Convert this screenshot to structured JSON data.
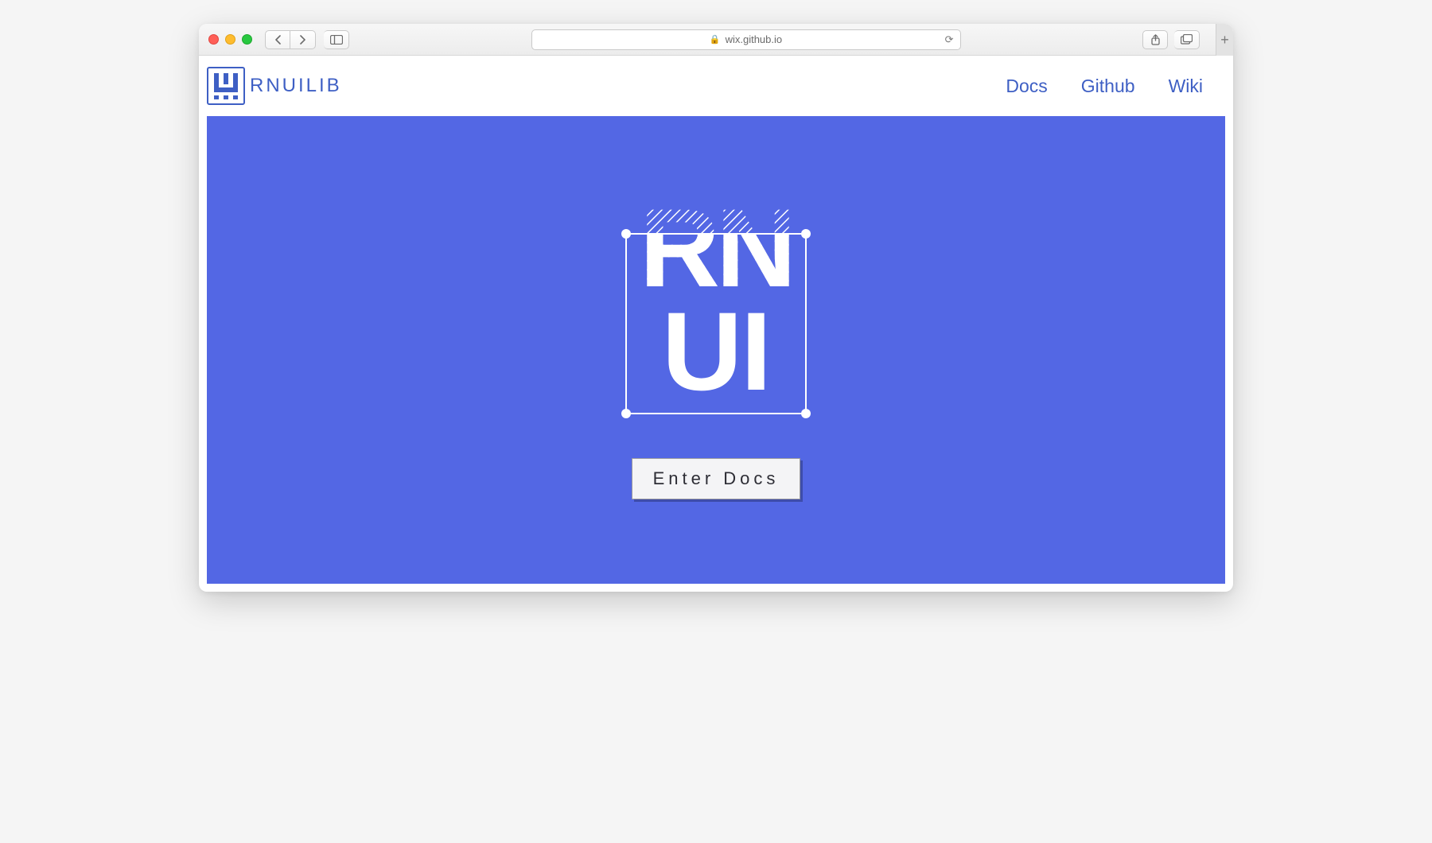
{
  "browser": {
    "url": "wix.github.io"
  },
  "site": {
    "brand": "RNUILIB",
    "nav": {
      "docs": "Docs",
      "github": "Github",
      "wiki": "Wiki"
    },
    "hero": {
      "cta": "Enter Docs"
    },
    "colors": {
      "accent": "#5367e4",
      "link": "#3e5fc4"
    }
  }
}
